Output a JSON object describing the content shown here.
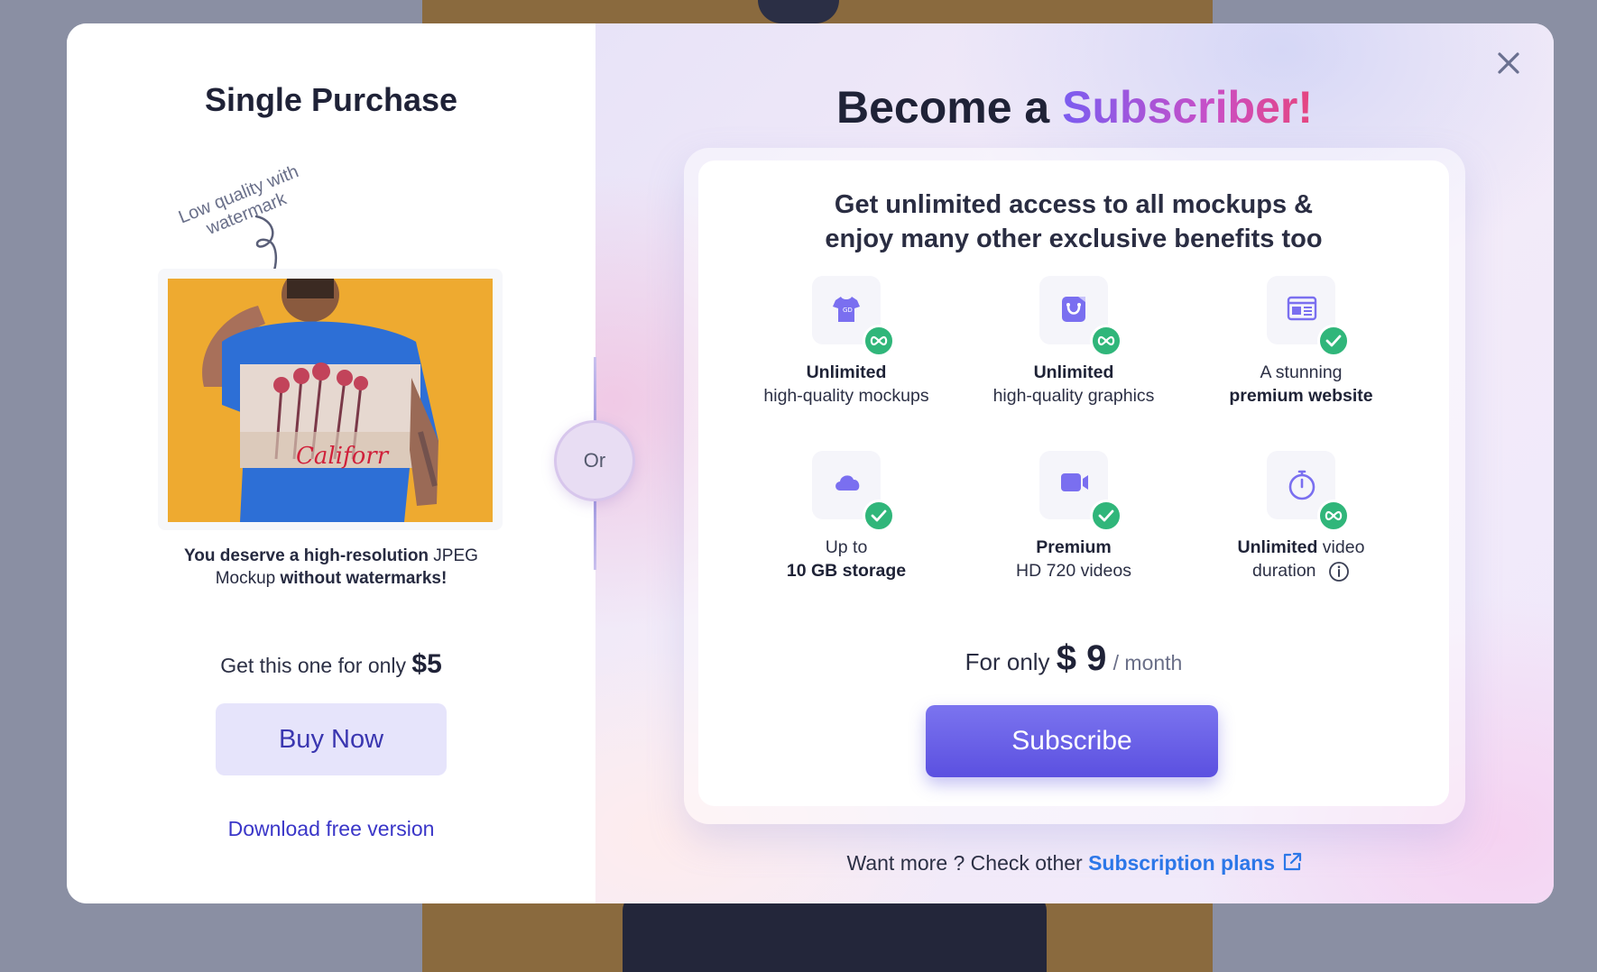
{
  "modal": {
    "close_label": "×"
  },
  "single": {
    "title": "Single Purchase",
    "annotation_line1": "Low quality with",
    "annotation_line2": "watermark",
    "desc_p1": "You deserve a ",
    "desc_b1": "high-resolution",
    "desc_p2": " JPEG",
    "desc_p3": "Mockup ",
    "desc_b2": "without watermarks!",
    "price_prefix": "Get this one for only",
    "price": "$5",
    "buy_label": "Buy Now",
    "download_label": "Download free version",
    "mockup_text": "Califorr"
  },
  "divider": {
    "or_label": "Or"
  },
  "subscribe": {
    "title_plain": "Become a ",
    "title_accent": "Subscriber!",
    "headline_line1": "Get unlimited access to all mockups &",
    "headline_line2": "enjoy many other exclusive benefits too",
    "features": [
      {
        "icon": "tshirt-icon",
        "badge": "infinity",
        "bold": "Unlimited",
        "normal": "high-quality mockups"
      },
      {
        "icon": "graphics-icon",
        "badge": "infinity",
        "bold": "Unlimited",
        "normal": "high-quality graphics"
      },
      {
        "icon": "website-icon",
        "badge": "check",
        "normal_top": "A stunning",
        "bold": "premium website"
      },
      {
        "icon": "cloud-icon",
        "badge": "check",
        "normal_top": "Up to",
        "bold": "10 GB storage"
      },
      {
        "icon": "video-icon",
        "badge": "check",
        "bold": "Premium",
        "normal": "HD 720 videos"
      },
      {
        "icon": "timer-icon",
        "badge": "infinity",
        "bold": "Unlimited",
        "normal_inline": " video",
        "normal": "duration"
      }
    ],
    "price_prefix": "For only",
    "price": "$ 9",
    "period": "/ month",
    "subscribe_label": "Subscribe",
    "more_text": "Want more ? Check other",
    "plans_link": "Subscription plans"
  },
  "colors": {
    "accent_purple": "#5b50e0",
    "badge_green": "#30b67a",
    "link_blue": "#2c77e8",
    "buy_bg": "#e6e4fb"
  }
}
